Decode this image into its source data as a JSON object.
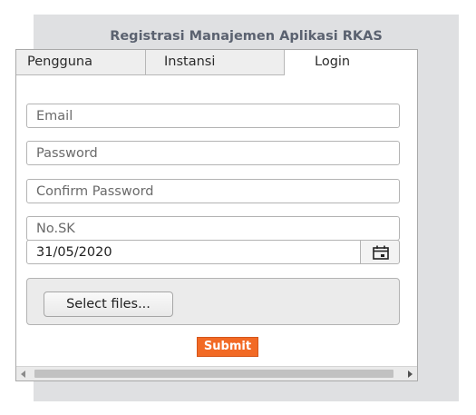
{
  "form": {
    "title": "Registrasi Manajemen Aplikasi RKAS",
    "tabs": [
      {
        "label": "Pengguna",
        "active": false
      },
      {
        "label": "Instansi",
        "active": false
      },
      {
        "label": "Login",
        "active": true
      }
    ],
    "fields": {
      "email_placeholder": "Email",
      "password_placeholder": "Password",
      "confirm_password_placeholder": "Confirm Password",
      "nosk_placeholder": "No.SK",
      "date_value": "31/05/2020"
    },
    "upload": {
      "select_label": "Select files..."
    },
    "submit_label": "Submit"
  },
  "icons": {
    "date_picker": "calendar-icon"
  },
  "colors": {
    "panel_bg": "#dfe0e2",
    "title_text": "#5b6270",
    "submit_bg": "#f26a25"
  }
}
